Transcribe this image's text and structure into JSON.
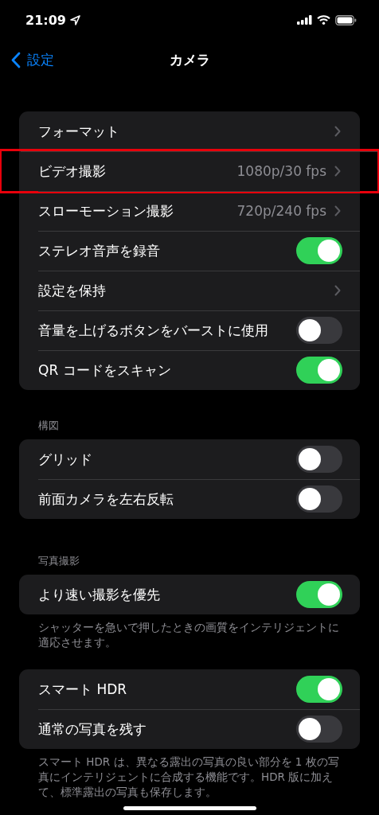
{
  "status_bar": {
    "time": "21:09"
  },
  "nav": {
    "back": "設定",
    "title": "カメラ"
  },
  "groups": [
    {
      "rows": [
        {
          "kind": "link",
          "label": "フォーマット",
          "highlighted": false
        },
        {
          "kind": "link",
          "label": "ビデオ撮影",
          "value": "1080p/30 fps",
          "highlighted": true
        },
        {
          "kind": "link",
          "label": "スローモーション撮影",
          "value": "720p/240 fps",
          "highlighted": false
        },
        {
          "kind": "toggle",
          "label": "ステレオ音声を録音",
          "on": true,
          "highlighted": false
        },
        {
          "kind": "link",
          "label": "設定を保持",
          "highlighted": false
        },
        {
          "kind": "toggle",
          "label": "音量を上げるボタンをバーストに使用",
          "on": false,
          "highlighted": false
        },
        {
          "kind": "toggle",
          "label": "QR コードをスキャン",
          "on": true,
          "highlighted": false
        }
      ]
    },
    {
      "header": "構図",
      "rows": [
        {
          "kind": "toggle",
          "label": "グリッド",
          "on": false,
          "highlighted": false
        },
        {
          "kind": "toggle",
          "label": "前面カメラを左右反転",
          "on": false,
          "highlighted": false
        }
      ]
    },
    {
      "header": "写真撮影",
      "rows": [
        {
          "kind": "toggle",
          "label": "より速い撮影を優先",
          "on": true,
          "highlighted": false
        }
      ],
      "footer": "シャッターを急いで押したときの画質をインテリジェントに適応させます。"
    },
    {
      "rows": [
        {
          "kind": "toggle",
          "label": "スマート HDR",
          "on": true,
          "highlighted": false
        },
        {
          "kind": "toggle",
          "label": "通常の写真を残す",
          "on": false,
          "highlighted": false
        }
      ],
      "footer": "スマート HDR は、異なる露出の写真の良い部分を 1 枚の写真にインテリジェントに合成する機能です。HDR 版に加えて、標準露出の写真も保存します。"
    }
  ]
}
